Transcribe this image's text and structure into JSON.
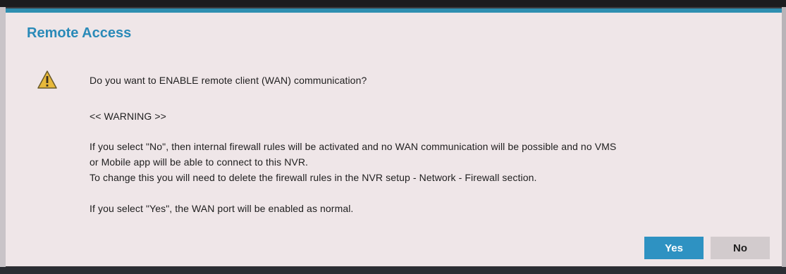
{
  "dialog": {
    "title": "Remote Access",
    "icon": "warning-triangle-icon",
    "question": "Do you want to ENABLE remote client (WAN) communication?",
    "warning": "<< WARNING >>",
    "no_explanation_line1": "If you select \"No\", then internal firewall rules will be activated and no WAN communication will be possible and no VMS",
    "no_explanation_line2": "or Mobile app will be able to connect to this NVR.",
    "change_instruction": "To change this you will need to delete the firewall rules in the NVR setup - Network - Firewall section.",
    "yes_explanation": "If you select \"Yes\", the WAN port will be enabled as normal.",
    "yes_label": "Yes",
    "no_label": "No"
  },
  "colors": {
    "accent": "#2e92c2",
    "title": "#2a8ab8",
    "dialog_background": "#efe6e8",
    "warning_icon_fill": "#e8b93a"
  }
}
